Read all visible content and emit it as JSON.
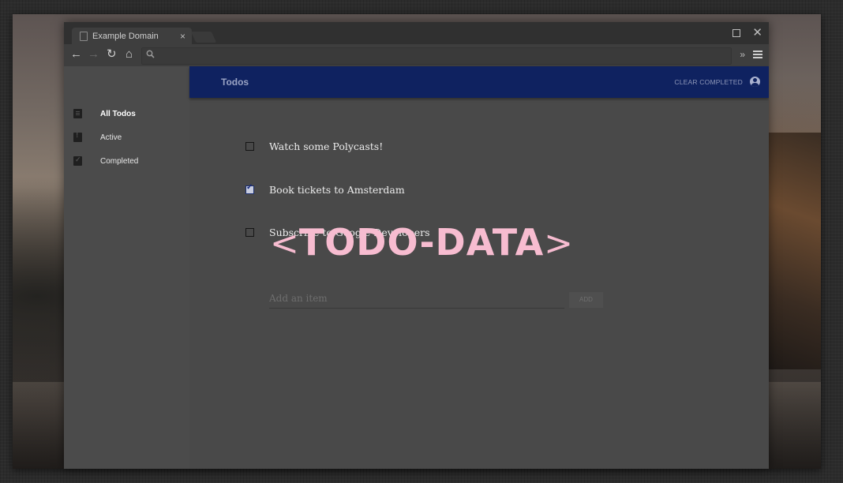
{
  "browser": {
    "tab_title": "Example Domain",
    "tab_close": "×",
    "window_close": "✕",
    "nav": {
      "back": "←",
      "forward": "→",
      "reload": "↻",
      "home": "⌂",
      "search": "🔍",
      "more": "»"
    }
  },
  "app": {
    "title": "Todos",
    "clear_completed": "CLEAR COMPLETED",
    "accent_color": "#0f2260"
  },
  "sidebar": {
    "items": [
      {
        "label": "All Todos",
        "icon": "clipboard-list-icon",
        "selected": true
      },
      {
        "label": "Active",
        "icon": "clipboard-alert-icon",
        "selected": false
      },
      {
        "label": "Completed",
        "icon": "clipboard-check-icon",
        "selected": false
      }
    ]
  },
  "todos": [
    {
      "text": "Watch some Polycasts!",
      "done": false
    },
    {
      "text": "Book tickets to Amsterdam",
      "done": true
    },
    {
      "text": "Subscribe to Google Developers",
      "done": false
    }
  ],
  "new_item": {
    "placeholder": "Add an item",
    "button": "ADD"
  },
  "overlay": {
    "open": "<",
    "label": "TODO-DATA",
    "close": ">"
  }
}
